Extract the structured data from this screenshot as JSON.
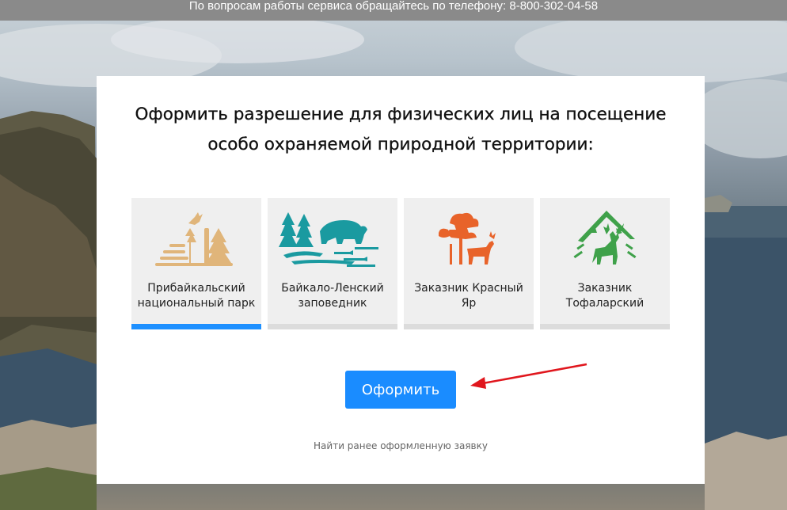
{
  "support_bar": {
    "text": "По вопросам работы сервиса обращайтесь по телефону: 8-800-302-04-58"
  },
  "main": {
    "title_line1": "Оформить разрешение для физических лиц на посещение",
    "title_line2": "особо охраняемой природной территории:",
    "territories": [
      {
        "label_line1": "Прибайкальский",
        "label_line2": "национальный парк",
        "icon": "pribaikalsky-park-logo-icon",
        "selected": true
      },
      {
        "label_line1": "Байкало-Ленский",
        "label_line2": "заповедник",
        "icon": "baikalo-lensky-reserve-logo-icon",
        "selected": false
      },
      {
        "label_line1": "Заказник Красный",
        "label_line2": "Яр",
        "icon": "krasny-yar-reserve-logo-icon",
        "selected": false
      },
      {
        "label_line1": "Заказник",
        "label_line2": "Тофаларский",
        "icon": "tofalarsky-reserve-logo-icon",
        "selected": false
      }
    ],
    "submit_label": "Оформить",
    "find_request_link": "Найти ранее оформленную заявку"
  },
  "colors": {
    "accent": "#1a8cff",
    "selected_bar": "#1e90ff",
    "pribaikalsky_logo": "#e0b57a",
    "baikalo_lensky_logo": "#1a9aa0",
    "krasny_yar_logo": "#e8632a",
    "tofalarsky_logo": "#3fa14a",
    "annotation_arrow": "#e0161d"
  }
}
